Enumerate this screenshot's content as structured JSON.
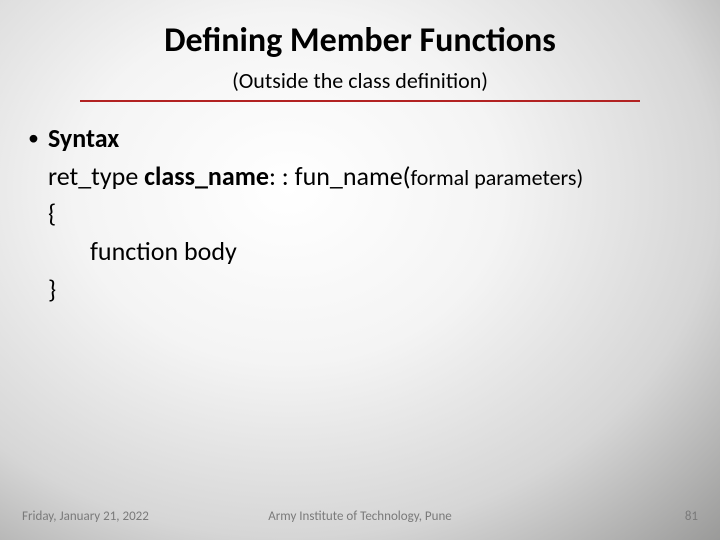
{
  "title": "Defining Member Functions",
  "subtitle": "(Outside the class definition)",
  "bullet_label": "Syntax",
  "code": {
    "line1_pre": "ret_type ",
    "line1_bold": "class_name",
    "line1_mid": ": : fun_name(",
    "line1_small": "formal parameters)",
    "line2": "{",
    "line3": "function body",
    "line4": "}"
  },
  "footer": {
    "left": "Friday, January 21, 2022",
    "center": "Army Institute of Technology, Pune",
    "right": "81"
  }
}
